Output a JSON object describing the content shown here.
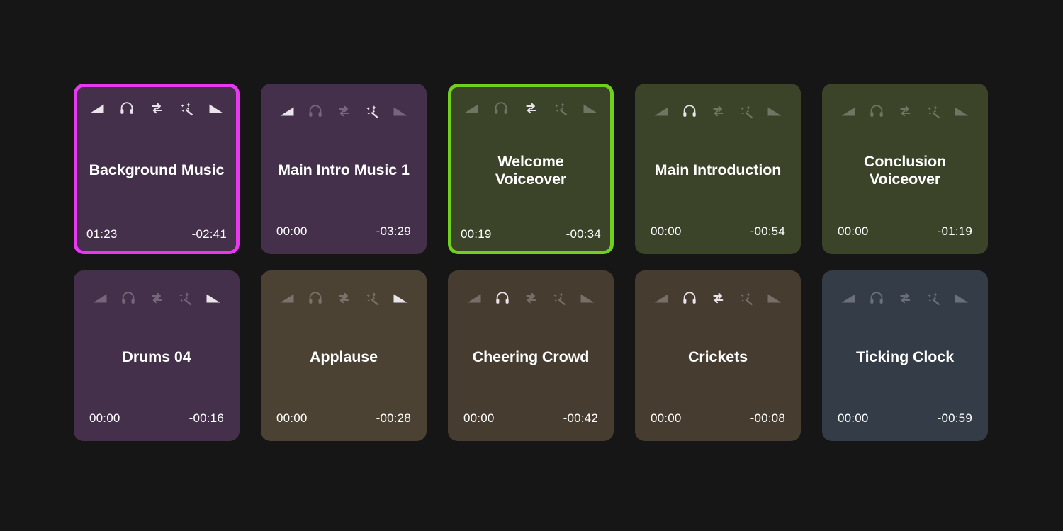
{
  "app": {
    "background_color": "#161616",
    "selected_border_magenta": "#e839f0",
    "selected_border_green": "#6fd01e"
  },
  "icons": {
    "fade_in": "fade-in-icon",
    "headphones": "headphones-icon",
    "loop": "loop-icon",
    "magic_wand": "magic-wand-icon",
    "fade_out": "fade-out-icon"
  },
  "clips": [
    {
      "title": "Background Music",
      "elapsed": "01:23",
      "remaining": "-02:41",
      "color": "#45304b",
      "selected": true,
      "selection_color": "#e839f0",
      "icon_states": {
        "fade_in": true,
        "headphones": true,
        "loop": true,
        "magic_wand": true,
        "fade_out": true
      }
    },
    {
      "title": "Main Intro Music 1",
      "elapsed": "00:00",
      "remaining": "-03:29",
      "color": "#45304b",
      "selected": false,
      "selection_color": "",
      "icon_states": {
        "fade_in": true,
        "headphones": false,
        "loop": false,
        "magic_wand": true,
        "fade_out": false
      }
    },
    {
      "title": "Welcome Voiceover",
      "elapsed": "00:19",
      "remaining": "-00:34",
      "color": "#3b4429",
      "selected": true,
      "selection_color": "#6fd01e",
      "icon_states": {
        "fade_in": false,
        "headphones": false,
        "loop": true,
        "magic_wand": false,
        "fade_out": false
      }
    },
    {
      "title": "Main Introduction",
      "elapsed": "00:00",
      "remaining": "-00:54",
      "color": "#3b4429",
      "selected": false,
      "selection_color": "",
      "icon_states": {
        "fade_in": false,
        "headphones": true,
        "loop": false,
        "magic_wand": false,
        "fade_out": false
      }
    },
    {
      "title": "Conclusion Voiceover",
      "elapsed": "00:00",
      "remaining": "-01:19",
      "color": "#3b4429",
      "selected": false,
      "selection_color": "",
      "icon_states": {
        "fade_in": false,
        "headphones": false,
        "loop": false,
        "magic_wand": false,
        "fade_out": false
      }
    },
    {
      "title": "Drums 04",
      "elapsed": "00:00",
      "remaining": "-00:16",
      "color": "#45304b",
      "selected": false,
      "selection_color": "",
      "icon_states": {
        "fade_in": false,
        "headphones": false,
        "loop": false,
        "magic_wand": false,
        "fade_out": true
      }
    },
    {
      "title": "Applause",
      "elapsed": "00:00",
      "remaining": "-00:28",
      "color": "#4c4234",
      "selected": false,
      "selection_color": "",
      "icon_states": {
        "fade_in": false,
        "headphones": false,
        "loop": false,
        "magic_wand": false,
        "fade_out": true
      }
    },
    {
      "title": "Cheering Crowd",
      "elapsed": "00:00",
      "remaining": "-00:42",
      "color": "#463c2f",
      "selected": false,
      "selection_color": "",
      "icon_states": {
        "fade_in": false,
        "headphones": true,
        "loop": false,
        "magic_wand": false,
        "fade_out": false
      }
    },
    {
      "title": "Crickets",
      "elapsed": "00:00",
      "remaining": "-00:08",
      "color": "#463c2f",
      "selected": false,
      "selection_color": "",
      "icon_states": {
        "fade_in": false,
        "headphones": true,
        "loop": true,
        "magic_wand": false,
        "fade_out": false
      }
    },
    {
      "title": "Ticking Clock",
      "elapsed": "00:00",
      "remaining": "-00:59",
      "color": "#343c48",
      "selected": false,
      "selection_color": "",
      "icon_states": {
        "fade_in": false,
        "headphones": false,
        "loop": false,
        "magic_wand": false,
        "fade_out": false
      }
    }
  ]
}
